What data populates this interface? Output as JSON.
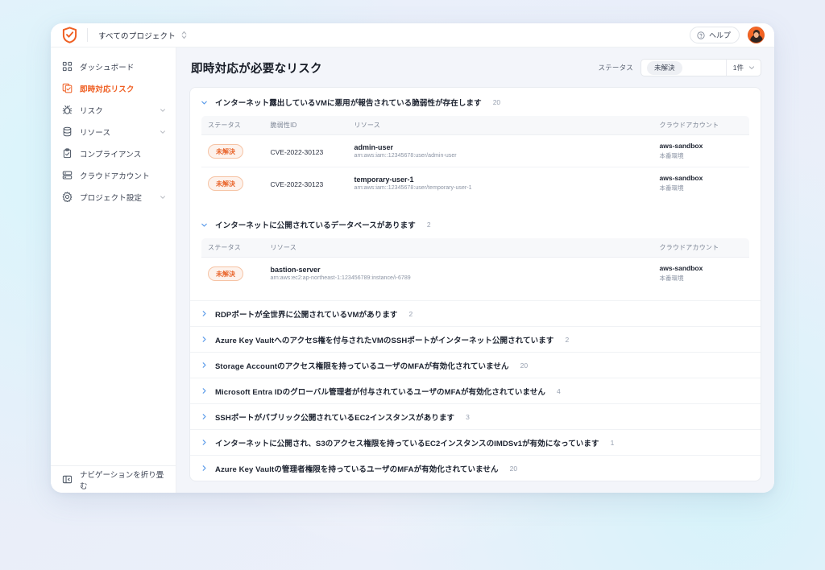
{
  "colors": {
    "brand_orange": "#ef5f23",
    "badge_text": "#e9642a",
    "badge_bg": "#fdf2ec",
    "badge_border": "#f6c3a4",
    "chevron_blue": "#5b9bea",
    "main_bg": "#f3f5fa"
  },
  "topbar": {
    "logo_icon": "shield-check-icon",
    "project_switcher": "すべてのプロジェクト",
    "project_switcher_icon": "chevron-up-down-icon",
    "help_label": "ヘルプ",
    "help_icon": "question-circle-icon",
    "avatar_icon": "user-avatar"
  },
  "sidebar": {
    "items": [
      {
        "label": "ダッシュボード",
        "icon": "dashboard-grid-icon",
        "active": false,
        "expandable": false
      },
      {
        "label": "即時対応リスク",
        "icon": "alert-copy-icon",
        "active": true,
        "expandable": false
      },
      {
        "label": "リスク",
        "icon": "bug-icon",
        "active": false,
        "expandable": true
      },
      {
        "label": "リソース",
        "icon": "database-icon",
        "active": false,
        "expandable": true
      },
      {
        "label": "コンプライアンス",
        "icon": "clipboard-check-icon",
        "active": false,
        "expandable": false
      },
      {
        "label": "クラウドアカウント",
        "icon": "server-stack-icon",
        "active": false,
        "expandable": false
      },
      {
        "label": "プロジェクト設定",
        "icon": "gear-icon",
        "active": false,
        "expandable": true
      }
    ],
    "collapse_label": "ナビゲーションを折り畳む",
    "collapse_icon": "panel-collapse-icon"
  },
  "main": {
    "page_title": "即時対応が必要なリスク",
    "filter": {
      "label": "ステータス",
      "selected_chip": "未解決",
      "count": "1件",
      "chevron_icon": "chevron-down-icon"
    },
    "expanded_groups": [
      {
        "title": "インターネット露出しているVMに悪用が報告されている脆弱性が存在します",
        "count": "20",
        "chevron_icon": "chevron-down-icon",
        "columns": [
          "ステータス",
          "脆弱性ID",
          "リソース",
          "クラウドアカウント"
        ],
        "has_cve_column": true,
        "rows": [
          {
            "status": "未解決",
            "cve": "CVE-2022-30123",
            "resource_name": "admin-user",
            "resource_arn": "arn:aws:iam::12345678:user/admin-user",
            "account_name": "aws-sandbox",
            "account_env": "本番環境"
          },
          {
            "status": "未解決",
            "cve": "CVE-2022-30123",
            "resource_name": "temporary-user-1",
            "resource_arn": "arn:aws:iam::12345678:user/temporary-user-1",
            "account_name": "aws-sandbox",
            "account_env": "本番環境"
          }
        ]
      },
      {
        "title": "インターネットに公開されているデータベースがあります",
        "count": "2",
        "chevron_icon": "chevron-down-icon",
        "columns": [
          "ステータス",
          "リソース",
          "クラウドアカウント"
        ],
        "has_cve_column": false,
        "rows": [
          {
            "status": "未解決",
            "cve": "",
            "resource_name": "bastion-server",
            "resource_arn": "arn:aws:ec2:ap-northeast-1:123456789:instance/i-6789",
            "account_name": "aws-sandbox",
            "account_env": "本番環境"
          }
        ]
      }
    ],
    "collapsed_groups": [
      {
        "title": "RDPポートが全世界に公開されているVMがあります",
        "count": "2",
        "chevron_icon": "chevron-right-icon"
      },
      {
        "title": "Azure Key VaultへのアクセS権を付与されたVMのSSHポートがインターネット公開されています",
        "count": "2",
        "chevron_icon": "chevron-right-icon"
      },
      {
        "title": "Storage Accountのアクセス権限を持っているユーザのMFAが有効化されていません",
        "count": "20",
        "chevron_icon": "chevron-right-icon"
      },
      {
        "title": "Microsoft Entra IDのグローバル管理者が付与されているユーザのMFAが有効化されていません",
        "count": "4",
        "chevron_icon": "chevron-right-icon"
      },
      {
        "title": "SSHポートがパブリック公開されているEC2インスタンスがあります",
        "count": "3",
        "chevron_icon": "chevron-right-icon"
      },
      {
        "title": "インターネットに公開され、S3のアクセス権限を持っているEC2インスタンスのIMDSv1が有効になっています",
        "count": "1",
        "chevron_icon": "chevron-right-icon"
      },
      {
        "title": "Azure Key Vaultの管理者権限を持っているユーザのMFAが有効化されていません",
        "count": "20",
        "chevron_icon": "chevron-right-icon"
      }
    ]
  }
}
